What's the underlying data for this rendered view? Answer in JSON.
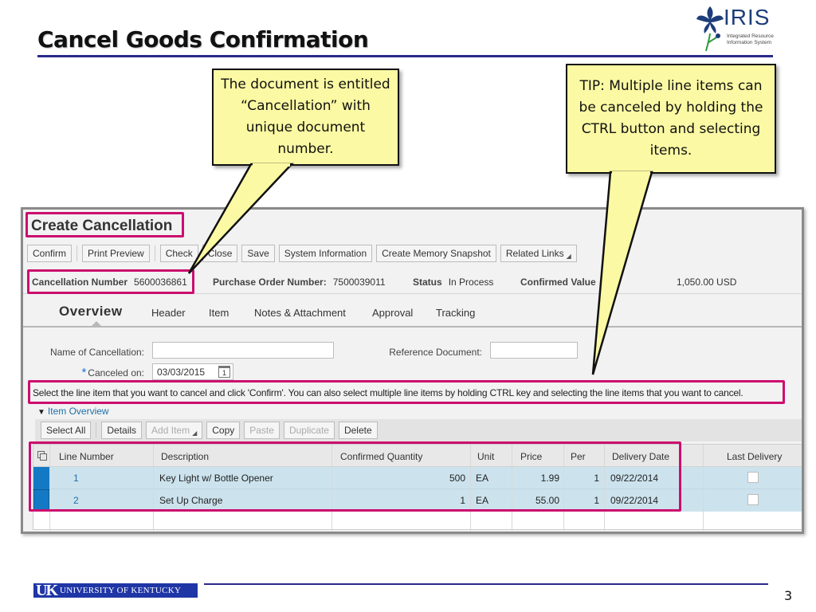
{
  "slide": {
    "title": "Cancel Goods Confirmation",
    "page_number": "3"
  },
  "logos": {
    "iris": {
      "word": "IRIS",
      "line1": "Integrated Resource",
      "line2": "Information System"
    },
    "uk": {
      "mark": "UK",
      "text": "UNIVERSITY OF KENTUCKY"
    }
  },
  "callouts": [
    {
      "text": "The document is entitled “Cancellation” with unique document number."
    },
    {
      "text": "TIP: Multiple line items can be canceled by holding the CTRL button and selecting items."
    }
  ],
  "sap": {
    "window_title": "Create Cancellation",
    "toolbar": [
      {
        "label": "Confirm",
        "enabled": true
      },
      {
        "label": "Print Preview",
        "enabled": true
      },
      {
        "label": "Check",
        "enabled": true
      },
      {
        "label": "Close",
        "enabled": true
      },
      {
        "label": "Save",
        "enabled": true
      },
      {
        "label": "System Information",
        "enabled": true
      },
      {
        "label": "Create Memory Snapshot",
        "enabled": true
      },
      {
        "label": "Related Links",
        "enabled": true,
        "dropdown": true
      }
    ],
    "info": {
      "cancellation_number_label": "Cancellation Number",
      "cancellation_number": "5600036861",
      "po_number_label": "Purchase Order Number:",
      "po_number": "7500039011",
      "status_label": "Status",
      "status": "In Process",
      "confirmed_value_label": "Confirmed Value",
      "confirmed_value": "1,050.00 USD"
    },
    "tabs": [
      {
        "label": "Overview",
        "active": true
      },
      {
        "label": "Header"
      },
      {
        "label": "Item"
      },
      {
        "label": "Notes & Attachment"
      },
      {
        "label": "Approval"
      },
      {
        "label": "Tracking"
      }
    ],
    "form": {
      "name_label": "Name of Cancellation:",
      "name_value": "",
      "reference_label": "Reference Document:",
      "reference_value": "",
      "canceled_on_label": "Canceled on:",
      "canceled_on_value": "03/03/2015",
      "required_mark": "*",
      "calendar_day": "1"
    },
    "instruction": "Select the line item that you want to cancel and click 'Confirm'. You can also select multiple line items by holding CTRL key and selecting the line items that you want to cancel.",
    "item_overview": {
      "label": "Item Overview",
      "toolbar": [
        {
          "label": "Select All",
          "enabled": true
        },
        {
          "label": "Details",
          "enabled": true
        },
        {
          "label": "Add Item",
          "enabled": false,
          "dropdown": true
        },
        {
          "label": "Copy",
          "enabled": true
        },
        {
          "label": "Paste",
          "enabled": false
        },
        {
          "label": "Duplicate",
          "enabled": false
        },
        {
          "label": "Delete",
          "enabled": true
        }
      ],
      "columns": [
        "Line Number",
        "Description",
        "Confirmed Quantity",
        "Unit",
        "Price",
        "Per",
        "Delivery Date",
        "Last Delivery"
      ],
      "rows": [
        {
          "line": "1",
          "description": "Key Light w/ Bottle Opener",
          "qty": "500",
          "unit": "EA",
          "price": "1.99",
          "per": "1",
          "delivery_date": "09/22/2014",
          "last_delivery": false,
          "selected": true
        },
        {
          "line": "2",
          "description": "Set Up Charge",
          "qty": "1",
          "unit": "EA",
          "price": "55.00",
          "per": "1",
          "delivery_date": "09/22/2014",
          "last_delivery": false,
          "selected": true
        }
      ]
    }
  },
  "colors": {
    "highlight": "#cc0e6e",
    "callout_fill": "#fbf9a3",
    "selected_row": "#cce3ee",
    "row_selector": "#1479c4",
    "rule": "#2a2a8a"
  }
}
